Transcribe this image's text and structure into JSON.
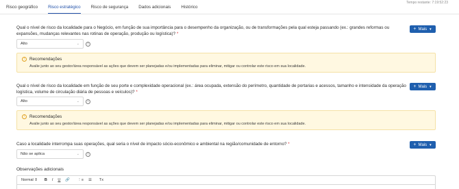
{
  "timer": "Tempo restante: 7:19:52:23",
  "tabs": [
    "Risco geográfico",
    "Risco estratégico",
    "Risco de segurança",
    "Dados adicionais",
    "Histórico"
  ],
  "questions": [
    {
      "text": "Qual o nível de risco da localidade para o Negócio, em função de sua importância para o desempenho da organização, ou de transformações pela qual esteja passando (ex.: grandes reformas ou expansões, mudanças relevantes nas rotinas de operação, produção ou logística)?",
      "required": "*",
      "value": "Alto"
    },
    {
      "text": "Qual o nível de risco da localidade em função de seu porte e complexidade operacional (ex.: área ocupada, extensão do perímetro, quantidade de portarias e acessos, tamanho e intensidade da operação logística, volume de circulação diária de pessoas e veículos)?",
      "required": "*",
      "value": "Alto"
    },
    {
      "text": "Caso a localidade interrompa suas operações, qual seria o nível de impacto sócio-econômico e ambiental na região/comunidade de entorno?",
      "required": "*",
      "value": "Não se aplica"
    }
  ],
  "recommendation": {
    "title": "Recomendações",
    "text": "Avalie junto ao seu gestor/área responsável as ações que devem ser planejadas e/ou implementadas para eliminar, mitigar ou controlar este risco em sua localidade."
  },
  "mais_label": "Mais",
  "observacoes_label": "Observações adicionais",
  "editor": {
    "format": "Normal",
    "bold": "B",
    "italic": "I",
    "underline": "U",
    "link": "🔗",
    "ordered_list": "⋮≡",
    "bullet_list": "☰",
    "clear_format": "Tx"
  },
  "icons": {
    "info": "info-icon",
    "warning": "warning-icon",
    "chevron": "chevron-down-icon"
  },
  "colors": {
    "accent": "#1f5fae",
    "tab_active": "#1f4fa8",
    "required": "#d9363e",
    "rec_bg": "#fff8e1",
    "rec_icon": "#e0a020"
  }
}
